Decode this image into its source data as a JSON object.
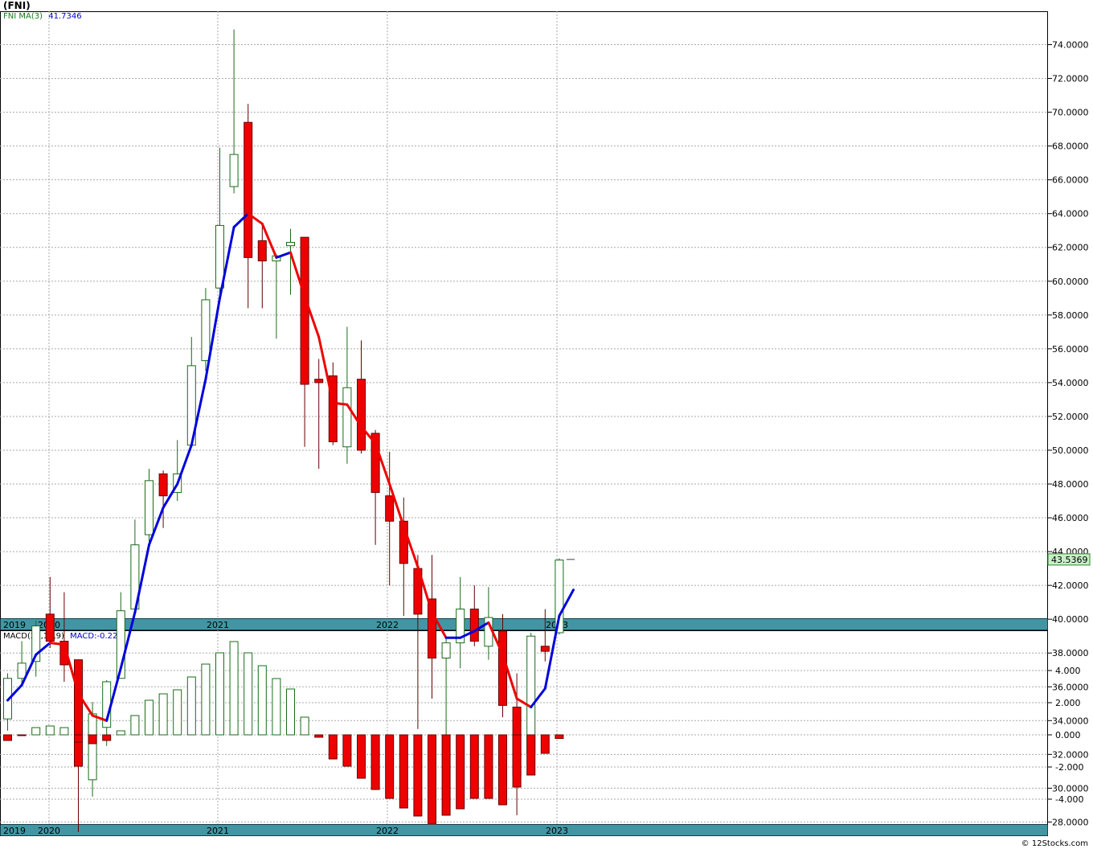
{
  "title": "(FNI)",
  "price_legend": {
    "symbol": "FNI",
    "indicator": "MA(3)",
    "value": "41.7346"
  },
  "macd_legend": {
    "indicator": "MACD(26,12,9)",
    "value": "MACD:-0.227"
  },
  "copyright": "© 12Stocks.com",
  "last_price_label": "43.5369",
  "colors": {
    "up": "#ffffff",
    "up_stroke": "#1a6b1a",
    "down": "#ee0000",
    "down_stroke": "#660000",
    "ma_up": "#0000dd",
    "ma_down": "#ee0000",
    "grid": "#aaaaaa",
    "axis_band": "#2e8b9a",
    "last_box": "#c8f0c8"
  },
  "chart_data": [
    {
      "type": "candlestick",
      "title": "(FNI)",
      "period": "monthly",
      "x_labels": [
        "2019",
        "2020",
        "2021",
        "2022",
        "2023"
      ],
      "ylim": [
        27,
        76
      ],
      "y_ticks": [
        "28.0000",
        "30.0000",
        "32.0000",
        "34.0000",
        "36.0000",
        "38.0000",
        "40.0000",
        "42.0000",
        "44.0000",
        "46.0000",
        "48.0000",
        "50.0000",
        "52.0000",
        "54.0000",
        "56.0000",
        "58.0000",
        "60.0000",
        "62.0000",
        "64.0000",
        "66.0000",
        "68.0000",
        "70.0000",
        "72.0000",
        "74.0000"
      ],
      "y_tick_values": [
        28,
        30,
        32,
        34,
        36,
        38,
        40,
        42,
        44,
        46,
        48,
        50,
        52,
        54,
        56,
        58,
        60,
        62,
        64,
        66,
        68,
        70,
        72,
        74
      ],
      "grid": true,
      "candles": [
        {
          "o": 34.1,
          "h": 36.8,
          "l": 33.4,
          "c": 36.5
        },
        {
          "o": 36.5,
          "h": 38.7,
          "l": 36.2,
          "c": 37.4
        },
        {
          "o": 37.5,
          "h": 39.9,
          "l": 36.6,
          "c": 39.6
        },
        {
          "o": 40.3,
          "h": 42.5,
          "l": 38.3,
          "c": 38.7
        },
        {
          "o": 38.7,
          "h": 41.6,
          "l": 36.3,
          "c": 37.3
        },
        {
          "o": 37.6,
          "h": 37.6,
          "l": 27.4,
          "c": 31.3
        },
        {
          "o": 30.5,
          "h": 35.1,
          "l": 29.5,
          "c": 34.4
        },
        {
          "o": 33.6,
          "h": 36.4,
          "l": 32.5,
          "c": 36.3
        },
        {
          "o": 36.5,
          "h": 41.6,
          "l": 36.5,
          "c": 40.5
        },
        {
          "o": 40.6,
          "h": 45.9,
          "l": 40.6,
          "c": 44.4
        },
        {
          "o": 45.0,
          "h": 48.9,
          "l": 44.5,
          "c": 48.2
        },
        {
          "o": 48.6,
          "h": 48.8,
          "l": 45.4,
          "c": 47.3
        },
        {
          "o": 47.5,
          "h": 50.6,
          "l": 47.0,
          "c": 48.6
        },
        {
          "o": 50.3,
          "h": 56.7,
          "l": 50.3,
          "c": 55.0
        },
        {
          "o": 55.3,
          "h": 59.6,
          "l": 54.7,
          "c": 58.9
        },
        {
          "o": 59.6,
          "h": 67.9,
          "l": 59.1,
          "c": 63.3
        },
        {
          "o": 65.6,
          "h": 74.9,
          "l": 65.2,
          "c": 67.5
        },
        {
          "o": 69.4,
          "h": 70.5,
          "l": 58.4,
          "c": 61.4
        },
        {
          "o": 62.4,
          "h": 63.4,
          "l": 58.4,
          "c": 61.2
        },
        {
          "o": 61.2,
          "h": 61.6,
          "l": 56.6,
          "c": 61.5
        },
        {
          "o": 62.1,
          "h": 63.1,
          "l": 59.2,
          "c": 62.3
        },
        {
          "o": 62.6,
          "h": 62.6,
          "l": 50.2,
          "c": 53.9
        },
        {
          "o": 54.2,
          "h": 55.4,
          "l": 48.9,
          "c": 54.0
        },
        {
          "o": 54.4,
          "h": 55.2,
          "l": 50.3,
          "c": 50.5
        },
        {
          "o": 50.2,
          "h": 57.3,
          "l": 49.2,
          "c": 53.7
        },
        {
          "o": 54.2,
          "h": 56.5,
          "l": 49.8,
          "c": 50.0
        },
        {
          "o": 51.0,
          "h": 51.2,
          "l": 44.4,
          "c": 47.5
        },
        {
          "o": 47.3,
          "h": 49.9,
          "l": 42.0,
          "c": 45.8
        },
        {
          "o": 45.8,
          "h": 47.2,
          "l": 40.2,
          "c": 43.3
        },
        {
          "o": 43.0,
          "h": 43.8,
          "l": 33.5,
          "c": 40.3
        },
        {
          "o": 41.2,
          "h": 43.8,
          "l": 35.3,
          "c": 37.7
        },
        {
          "o": 37.7,
          "h": 39.0,
          "l": 32.3,
          "c": 38.6
        },
        {
          "o": 38.6,
          "h": 42.5,
          "l": 37.1,
          "c": 40.6
        },
        {
          "o": 40.6,
          "h": 42.0,
          "l": 38.4,
          "c": 38.7
        },
        {
          "o": 38.4,
          "h": 41.9,
          "l": 37.6,
          "c": 40.1
        },
        {
          "o": 39.3,
          "h": 40.3,
          "l": 34.2,
          "c": 34.9
        },
        {
          "o": 34.8,
          "h": 36.8,
          "l": 28.4,
          "c": 30.7
        },
        {
          "o": 32.0,
          "h": 39.2,
          "l": 30.9,
          "c": 39.0
        },
        {
          "o": 38.4,
          "h": 40.6,
          "l": 37.5,
          "c": 38.1
        },
        {
          "o": 39.2,
          "h": 43.6,
          "l": 39.1,
          "c": 43.5
        }
      ],
      "ma_series": {
        "name": "MA(3)",
        "values": [
          35.2,
          36.1,
          37.9,
          38.6,
          38.5,
          35.6,
          34.3,
          34.0,
          37.1,
          40.4,
          44.4,
          46.6,
          48.0,
          50.3,
          54.2,
          59.0,
          63.2,
          64.0,
          63.4,
          61.4,
          61.7,
          59.1,
          56.7,
          52.8,
          52.7,
          51.4,
          50.4,
          48.0,
          45.5,
          43.1,
          40.4,
          38.9,
          38.9,
          39.3,
          39.8,
          37.9,
          35.3,
          34.8,
          35.9,
          40.2,
          41.7346
        ],
        "x_offset": 0
      },
      "last_price": 43.5369
    },
    {
      "type": "bar",
      "title": "MACD(26,12,9)",
      "ylim": [
        -5.6,
        5.8
      ],
      "y_ticks": [
        "-4.000",
        "-2.000",
        "0.000",
        "2.000",
        "4.000"
      ],
      "y_tick_values": [
        -4,
        -2,
        0,
        2,
        4
      ],
      "x_labels": [
        "2019",
        "2020",
        "2021",
        "2022",
        "2023"
      ],
      "values": [
        -0.35,
        -0.05,
        0.45,
        0.55,
        0.45,
        -0.45,
        -0.55,
        -0.35,
        0.25,
        1.2,
        2.15,
        2.55,
        2.8,
        3.6,
        4.4,
        5.1,
        5.8,
        5.1,
        4.3,
        3.5,
        2.85,
        1.1,
        -0.15,
        -1.5,
        -1.95,
        -2.7,
        -3.4,
        -3.95,
        -4.55,
        -5.05,
        -5.55,
        -5.0,
        -4.6,
        -3.95,
        -3.95,
        -4.35,
        -3.25,
        -2.5,
        -1.15,
        -0.227
      ]
    }
  ]
}
